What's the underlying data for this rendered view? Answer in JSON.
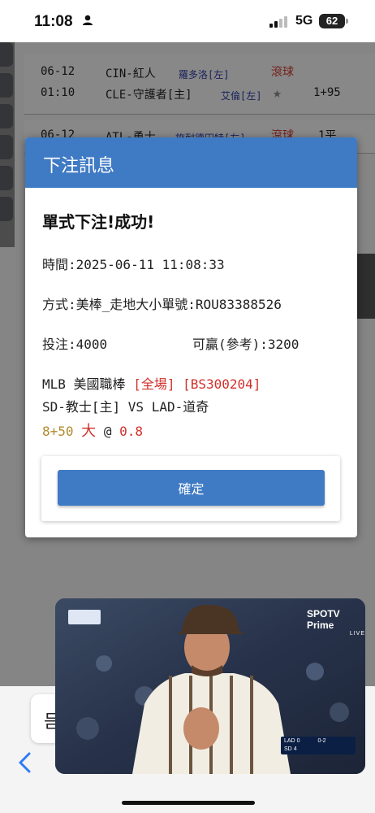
{
  "status_bar": {
    "time": "11:08",
    "network": "5G",
    "battery": "62"
  },
  "background_rows": [
    {
      "date": "06-12",
      "time": "01:10",
      "team1": "CIN-紅人",
      "team2": "CLE-守護者[主]",
      "pitcher1": "羅多洛[左]",
      "pitcher2": "艾倫[左]",
      "status": "滾球",
      "line": "1+95"
    },
    {
      "date": "06-12",
      "team1": "ATL-勇士",
      "pitcher1": "施耐德田特[左]",
      "status": "滾球",
      "line": "1平"
    }
  ],
  "modal": {
    "header": "下注訊息",
    "success": "單式下注!成功!",
    "time_line": "時間:2025-06-11 11:08:33",
    "method_line": "方式:美棒_走地大小單號:ROU83388526",
    "stake": "投注:4000",
    "win": "可贏(參考):3200",
    "league": "MLB 美國職棒",
    "scope": "[全場]",
    "code": "[BS300204]",
    "matchup": "SD-教士[主] VS LAD-道奇",
    "handicap": "8+50",
    "pick": "大",
    "at": "@",
    "odds": "0.8",
    "confirm": "確定"
  },
  "bottom": {
    "pill_text": "믐"
  },
  "video": {
    "brand": "SPOTV Prime",
    "brand_sub": "LIVE",
    "score": {
      "away": "LAD",
      "away_runs": "0",
      "home": "SD",
      "home_runs": "4",
      "count": "0-2"
    }
  },
  "colors": {
    "accent": "#3f7ac4",
    "highlight_red": "#d0302a",
    "handicap_gold": "#b28a2a"
  }
}
